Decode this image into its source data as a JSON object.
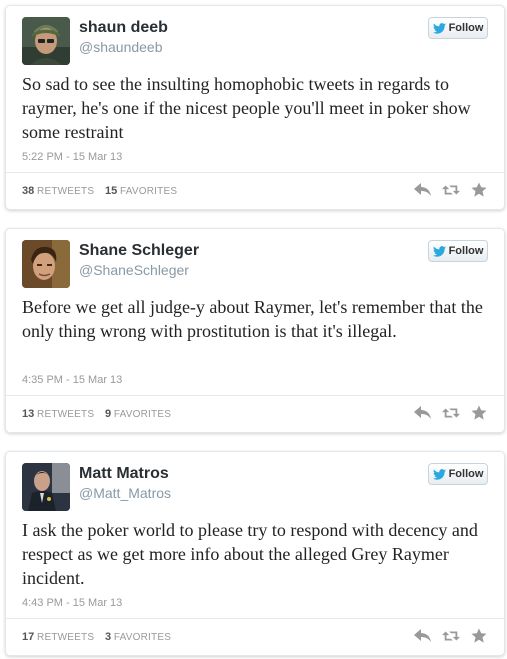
{
  "tweets": [
    {
      "display_name": "shaun deeb",
      "handle": "@shaundeeb",
      "follow_label": "Follow",
      "text": "So sad to see the insulting homophobic tweets in regards to raymer, he's one if the nicest people you'll meet in poker show some restraint",
      "timestamp": "5:22 PM - 15 Mar 13",
      "retweets": "38",
      "retweets_label": "RETWEETS",
      "favorites": "15",
      "favorites_label": "FAVORITES"
    },
    {
      "display_name": "Shane Schleger",
      "handle": "@ShaneSchleger",
      "follow_label": "Follow",
      "text": "Before we get all judge-y about Raymer, let's remember that the only thing wrong with prostitution is that it's illegal.",
      "timestamp": "4:35 PM - 15 Mar 13",
      "retweets": "13",
      "retweets_label": "RETWEETS",
      "favorites": "9",
      "favorites_label": "FAVORITES"
    },
    {
      "display_name": "Matt Matros",
      "handle": "@Matt_Matros",
      "follow_label": "Follow",
      "text": "I ask the poker world to please try to respond with decency and respect as we get more info about the alleged Grey Raymer incident.",
      "timestamp": "4:43 PM - 15 Mar 13",
      "retweets": "17",
      "retweets_label": "RETWEETS",
      "favorites": "3",
      "favorites_label": "FAVORITES"
    }
  ],
  "colors": {
    "twitter_blue": "#2aa9e0",
    "action_gray": "#999999",
    "name_color": "#292f33",
    "handle_color": "#8899a6"
  },
  "icons": [
    "twitter-bird-icon",
    "reply-icon",
    "retweet-icon",
    "favorite-star-icon"
  ]
}
